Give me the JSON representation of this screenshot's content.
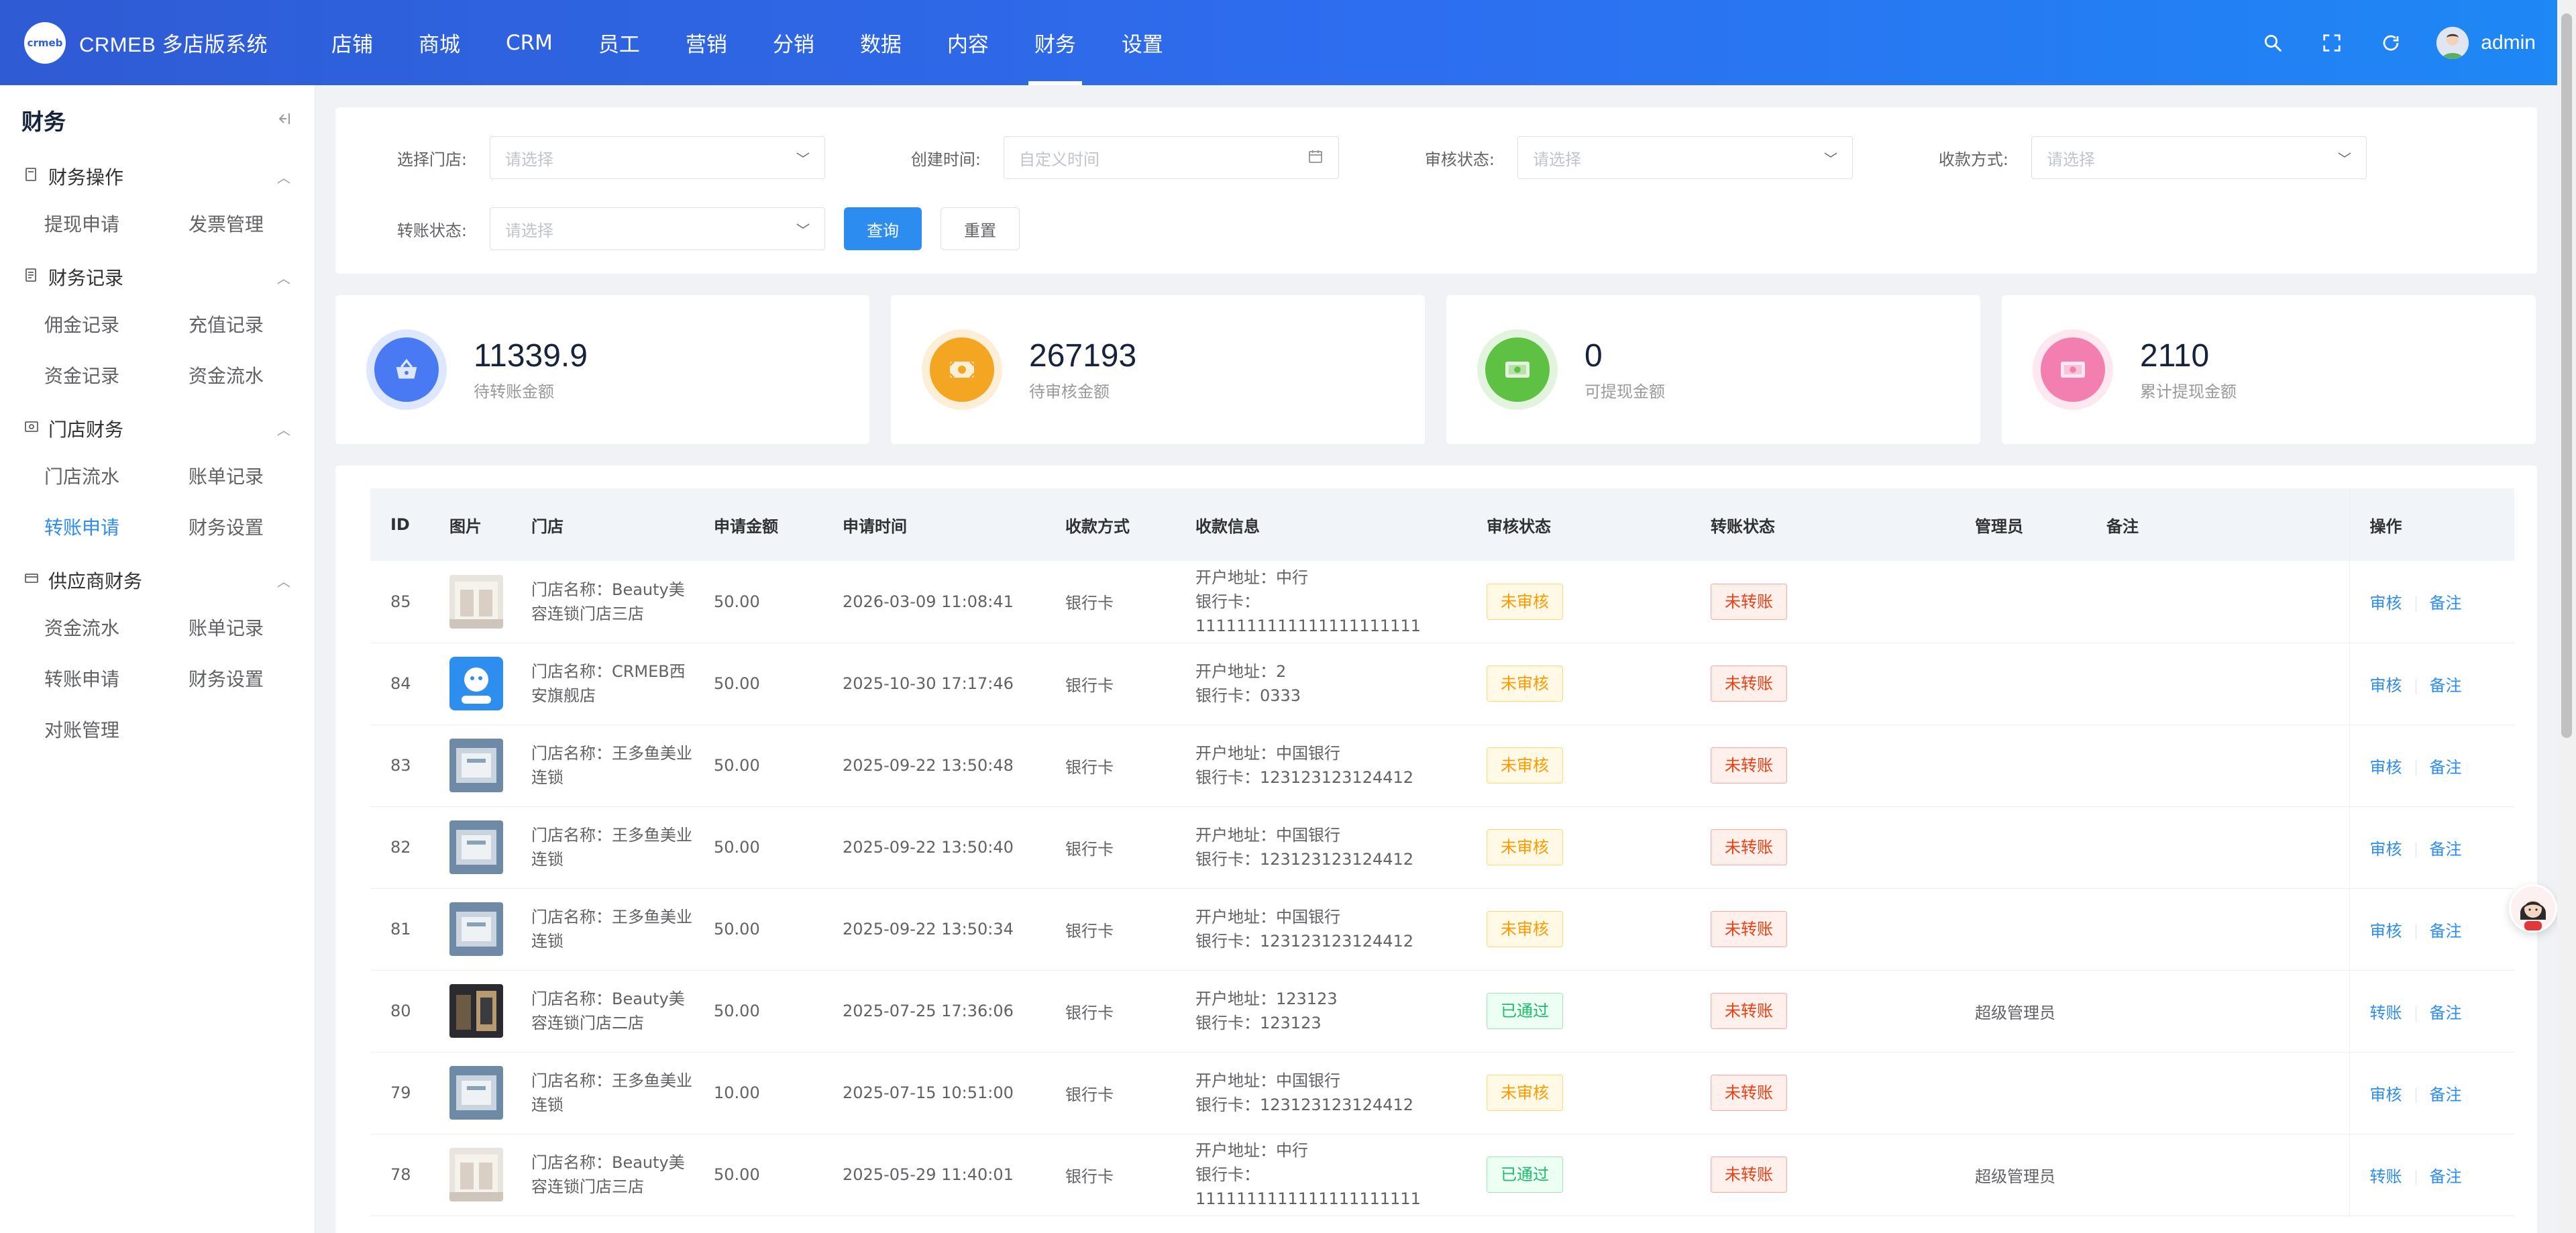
{
  "app": {
    "logo_text": "crmeb",
    "brand_name": "CRMEB 多店版系统",
    "user_name": "admin"
  },
  "nav": [
    {
      "label": "店铺"
    },
    {
      "label": "商城"
    },
    {
      "label": "CRM"
    },
    {
      "label": "员工"
    },
    {
      "label": "营销"
    },
    {
      "label": "分销"
    },
    {
      "label": "数据"
    },
    {
      "label": "内容"
    },
    {
      "label": "财务",
      "active": true
    },
    {
      "label": "设置"
    }
  ],
  "sidebar": {
    "title": "财务",
    "groups": [
      {
        "label": "财务操作",
        "icon": "document-icon",
        "items": [
          "提现申请",
          "发票管理"
        ]
      },
      {
        "label": "财务记录",
        "icon": "ledger-icon",
        "items": [
          "佣金记录",
          "充值记录",
          "资金记录",
          "资金流水"
        ]
      },
      {
        "label": "门店财务",
        "icon": "store-icon",
        "items": [
          "门店流水",
          "账单记录",
          "转账申请",
          "财务设置"
        ],
        "active_item": "转账申请"
      },
      {
        "label": "供应商财务",
        "icon": "card-icon",
        "items": [
          "资金流水",
          "账单记录",
          "转账申请",
          "财务设置",
          "对账管理"
        ]
      }
    ]
  },
  "filters": {
    "store": {
      "label": "选择门店:",
      "placeholder": "请选择"
    },
    "created": {
      "label": "创建时间:",
      "placeholder": "自定义时间"
    },
    "audit": {
      "label": "审核状态:",
      "placeholder": "请选择"
    },
    "payment": {
      "label": "收款方式:",
      "placeholder": "请选择"
    },
    "transfer": {
      "label": "转账状态:",
      "placeholder": "请选择"
    },
    "query_label": "查询",
    "reset_label": "重置"
  },
  "stats": [
    {
      "value": "11339.9",
      "label": "待转账金额",
      "color": "#4a7af5",
      "icon": "basket-icon"
    },
    {
      "value": "267193",
      "label": "待审核金额",
      "color": "#f5a623",
      "icon": "cash-icon"
    },
    {
      "value": "0",
      "label": "可提现金额",
      "color": "#5fc144",
      "icon": "money-icon"
    },
    {
      "value": "2110",
      "label": "累计提现金额",
      "color": "#f27fb0",
      "icon": "wallet-icon"
    }
  ],
  "table": {
    "headers": [
      "ID",
      "图片",
      "门店",
      "申请金额",
      "申请时间",
      "收款方式",
      "收款信息",
      "审核状态",
      "转账状态",
      "管理员",
      "备注",
      "操作"
    ],
    "rows": [
      {
        "id": "85",
        "img": "store-a",
        "store": "门店名称：Beauty美容连锁门店三店",
        "amount": "50.00",
        "time": "2026-03-09 11:08:41",
        "method": "银行卡",
        "info1": "开户地址：中行",
        "info2": "银行卡：1111111111111111111111",
        "audit": "未审核",
        "audit_type": "warn",
        "transfer": "未转账",
        "admin": "",
        "remark": "",
        "op1": "审核",
        "op2": "备注"
      },
      {
        "id": "84",
        "img": "store-logo",
        "store": "门店名称：CRMEB西安旗舰店",
        "amount": "50.00",
        "time": "2025-10-30 17:17:46",
        "method": "银行卡",
        "info1": "开户地址：2",
        "info2": "银行卡：0333",
        "audit": "未审核",
        "audit_type": "warn",
        "transfer": "未转账",
        "admin": "",
        "remark": "",
        "op1": "审核",
        "op2": "备注"
      },
      {
        "id": "83",
        "img": "store-b",
        "store": "门店名称：王多鱼美业连锁",
        "amount": "50.00",
        "time": "2025-09-22 13:50:48",
        "method": "银行卡",
        "info1": "开户地址：中国银行",
        "info2": "银行卡：123123123124412",
        "audit": "未审核",
        "audit_type": "warn",
        "transfer": "未转账",
        "admin": "",
        "remark": "",
        "op1": "审核",
        "op2": "备注"
      },
      {
        "id": "82",
        "img": "store-b",
        "store": "门店名称：王多鱼美业连锁",
        "amount": "50.00",
        "time": "2025-09-22 13:50:40",
        "method": "银行卡",
        "info1": "开户地址：中国银行",
        "info2": "银行卡：123123123124412",
        "audit": "未审核",
        "audit_type": "warn",
        "transfer": "未转账",
        "admin": "",
        "remark": "",
        "op1": "审核",
        "op2": "备注"
      },
      {
        "id": "81",
        "img": "store-b",
        "store": "门店名称：王多鱼美业连锁",
        "amount": "50.00",
        "time": "2025-09-22 13:50:34",
        "method": "银行卡",
        "info1": "开户地址：中国银行",
        "info2": "银行卡：123123123124412",
        "audit": "未审核",
        "audit_type": "warn",
        "transfer": "未转账",
        "admin": "",
        "remark": "",
        "op1": "审核",
        "op2": "备注"
      },
      {
        "id": "80",
        "img": "store-c",
        "store": "门店名称：Beauty美容连锁门店二店",
        "amount": "50.00",
        "time": "2025-07-25 17:36:06",
        "method": "银行卡",
        "info1": "开户地址：123123",
        "info2": "银行卡：123123",
        "audit": "已通过",
        "audit_type": "ok",
        "transfer": "未转账",
        "admin": "超级管理员",
        "remark": "",
        "op1": "转账",
        "op2": "备注"
      },
      {
        "id": "79",
        "img": "store-b",
        "store": "门店名称：王多鱼美业连锁",
        "amount": "10.00",
        "time": "2025-07-15 10:51:00",
        "method": "银行卡",
        "info1": "开户地址：中国银行",
        "info2": "银行卡：123123123124412",
        "audit": "未审核",
        "audit_type": "warn",
        "transfer": "未转账",
        "admin": "",
        "remark": "",
        "op1": "审核",
        "op2": "备注"
      },
      {
        "id": "78",
        "img": "store-a",
        "store": "门店名称：Beauty美容连锁门店三店",
        "amount": "50.00",
        "time": "2025-05-29 11:40:01",
        "method": "银行卡",
        "info1": "开户地址：中行",
        "info2": "银行卡：1111111111111111111111",
        "audit": "已通过",
        "audit_type": "ok",
        "transfer": "未转账",
        "admin": "超级管理员",
        "remark": "",
        "op1": "转账",
        "op2": "备注"
      }
    ]
  }
}
